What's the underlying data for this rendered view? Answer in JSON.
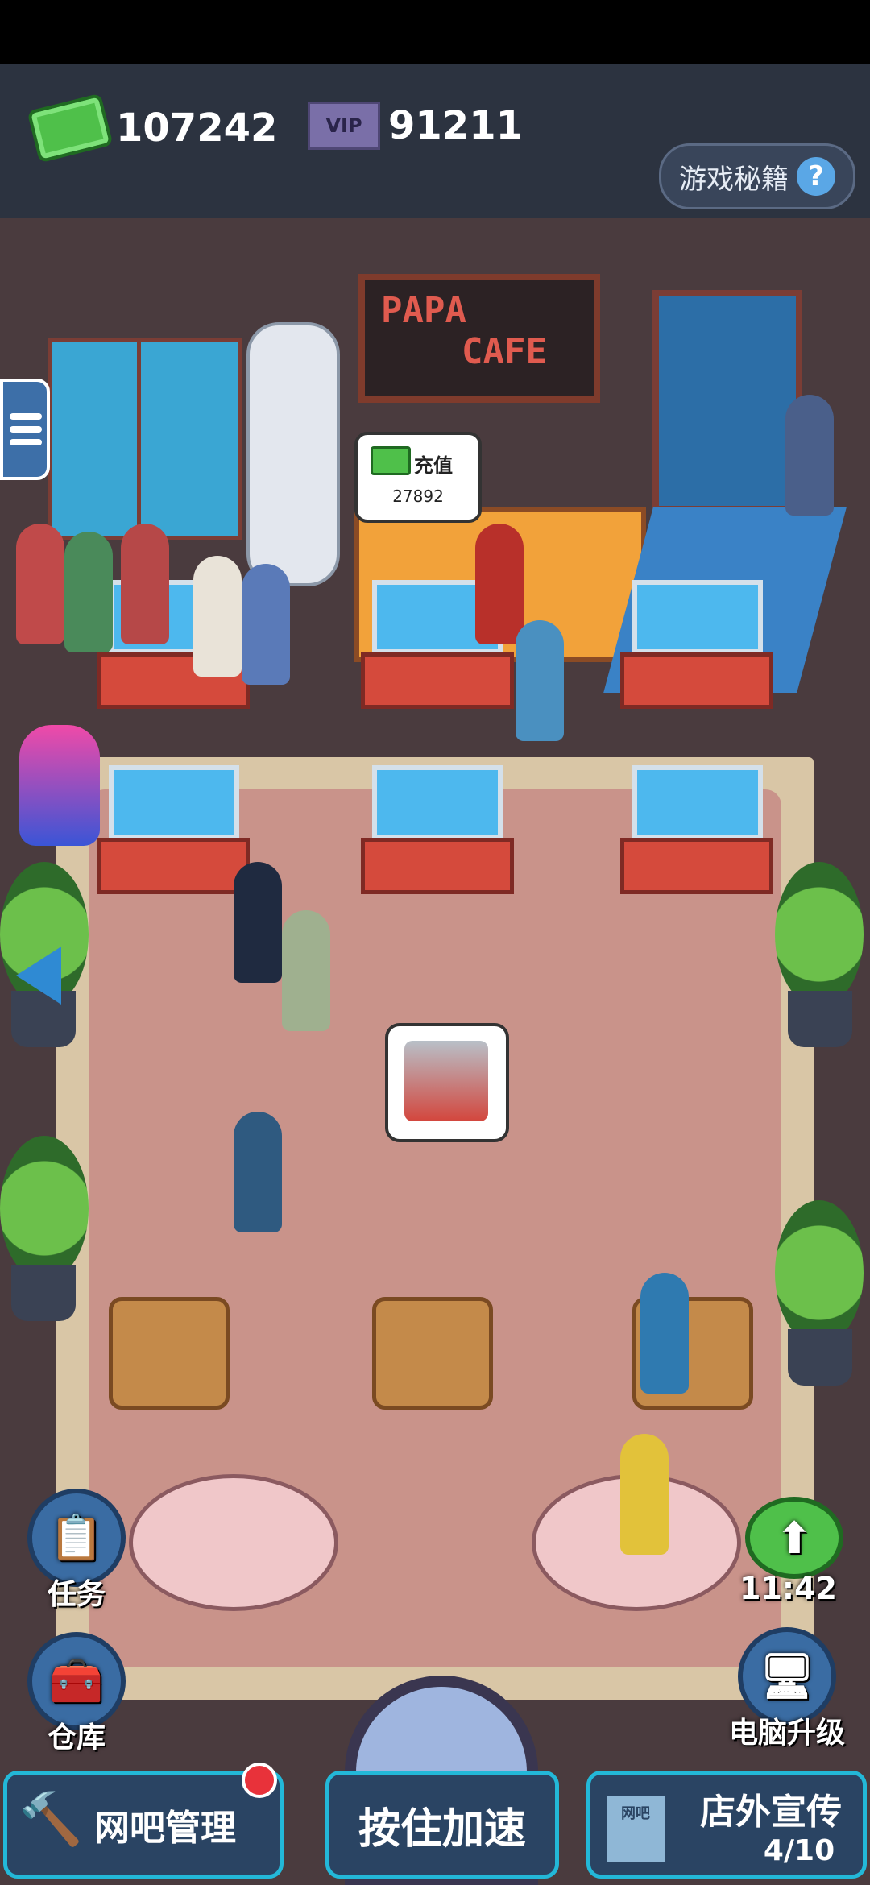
{
  "currency": {
    "cash": "107242",
    "vip": "91211",
    "vip_icon_text": "VIP"
  },
  "help_button": {
    "label": "游戏秘籍",
    "icon": "?"
  },
  "cafe_sign": {
    "line1": "PAPA",
    "line2": "CAFE"
  },
  "recharge_bubble": {
    "label": "充值",
    "value": "27892"
  },
  "side_buttons": {
    "tasks": "任务",
    "warehouse": "仓库",
    "pc_upgrade": "电脑升级"
  },
  "income_timer": "11:42",
  "bottom_bar": {
    "manage": "网吧管理",
    "speed_up": "按住加速",
    "promo": "店外宣传",
    "promo_count": "4/10",
    "promo_icon_text": "网吧"
  },
  "colors": {
    "accent": "#23b8d8",
    "cash_green": "#4fc04a",
    "notification": "#e8323a"
  }
}
